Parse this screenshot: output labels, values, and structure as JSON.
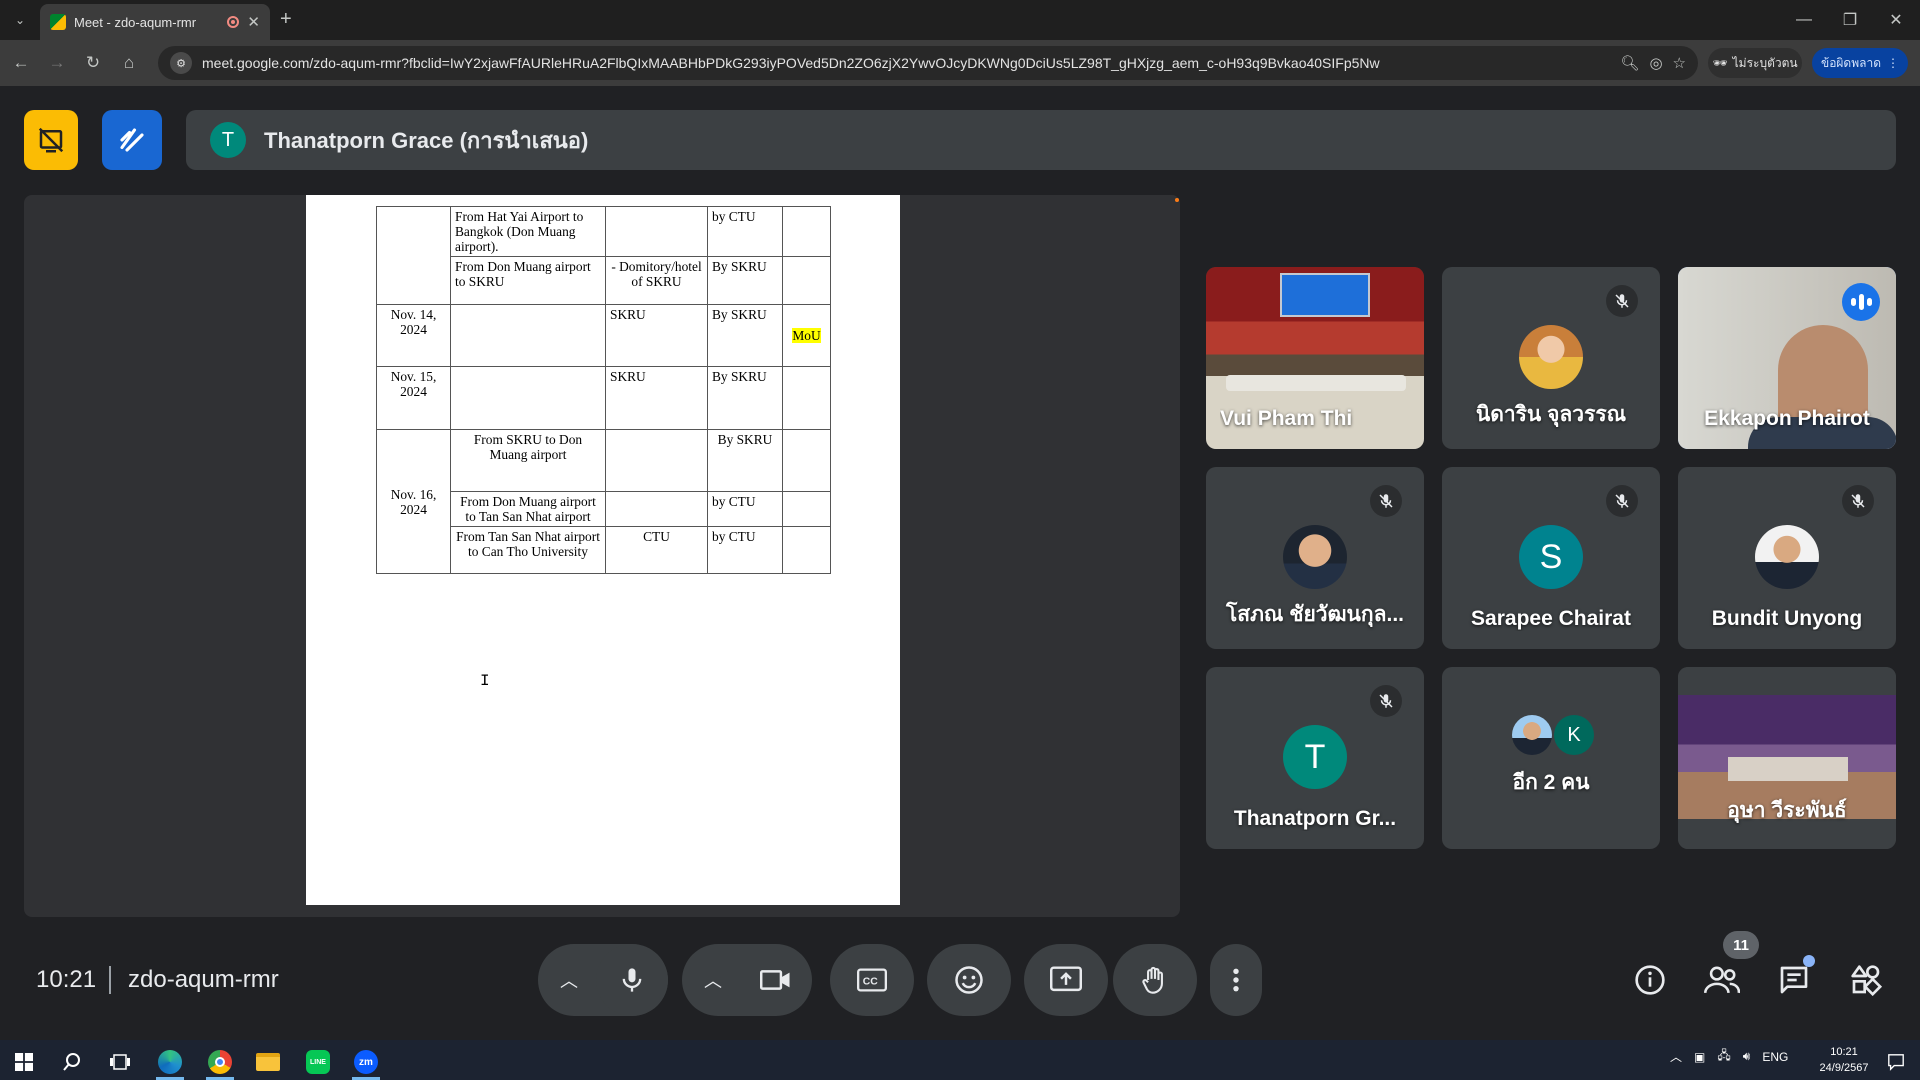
{
  "browser": {
    "tab_title": "Meet - zdo-aqum-rmr",
    "new_tab": "+",
    "url": "meet.google.com/zdo-aqum-rmr?fbclid=IwY2xjawFfAURleHRuA2FlbQIxMAABHbPDkG293iyPOVed5Dn2ZO6zjX2YwvOJcyDKWNg0DciUs5LZ98T_gHXjzg_aem_c-oH93q9Bvkao40SIFp5Nw",
    "incognito_label": "ไม่ระบุตัวตน",
    "update_label": "ข้อผิดพลาด"
  },
  "meet": {
    "presenter_initial": "T",
    "presenter_label": "Thanatporn Grace (การนำเสนอ)",
    "clock": "10:21",
    "meeting_code": "zdo-aqum-rmr",
    "participant_count": "11",
    "accent_colors": {
      "leave": "#ea4335",
      "speaking": "#8ab4f8",
      "yellow_button": "#fbbc04",
      "blue_button": "#1967d2"
    }
  },
  "document": {
    "rows": [
      {
        "date": "",
        "route": "From Hat Yai Airport to Bangkok (Don Muang airport).",
        "stay": "",
        "by": "by CTU",
        "note": ""
      },
      {
        "route": "From Don Muang airport to SKRU",
        "stay": "- Domitory/hotel of SKRU",
        "by": "By  SKRU",
        "note": ""
      },
      {
        "date": "Nov. 14, 2024",
        "route": "",
        "stay": "SKRU",
        "by": "By SKRU",
        "note": "MoU"
      },
      {
        "date": "Nov. 15, 2024",
        "route": "",
        "stay": "SKRU",
        "by": "By SKRU",
        "note": ""
      },
      {
        "date": "Nov. 16, 2024",
        "route": "From SKRU to Don Muang airport",
        "stay": "",
        "by": "By SKRU",
        "note": ""
      },
      {
        "route": "From Don Muang airport to Tan San Nhat airport",
        "stay": "",
        "by": "by CTU",
        "note": ""
      },
      {
        "route": "From Tan San Nhat airport to Can Tho University",
        "stay": "CTU",
        "by": "by CTU",
        "note": ""
      }
    ],
    "cursor_glyph": "I"
  },
  "participants": [
    {
      "name": "Vui Pham Thi",
      "type": "video-room",
      "muted": false
    },
    {
      "name": "นิดาริน จุลวรรณ",
      "type": "photo",
      "muted": true
    },
    {
      "name": "Ekkapon Phairot",
      "type": "video-person",
      "muted": false,
      "speaking": true
    },
    {
      "name": "โสภณ ชัยวัฒนกุล...",
      "type": "photo",
      "muted": true
    },
    {
      "name": "Sarapee Chairat",
      "type": "letter",
      "initial": "S",
      "color": "#00838f",
      "muted": true
    },
    {
      "name": "Bundit Unyong",
      "type": "photo",
      "muted": true
    },
    {
      "name": "Thanatporn Gr...",
      "type": "letter",
      "initial": "T",
      "color": "#00897b",
      "muted": true
    },
    {
      "name": "อีก 2 คน",
      "type": "group",
      "initial": "K",
      "color": "#00695c"
    },
    {
      "name": "อุษา วีระพันธ์",
      "type": "video-room2",
      "muted": false
    }
  ],
  "taskbar": {
    "lang": "ENG",
    "time": "10:21",
    "date": "24/9/2567"
  }
}
